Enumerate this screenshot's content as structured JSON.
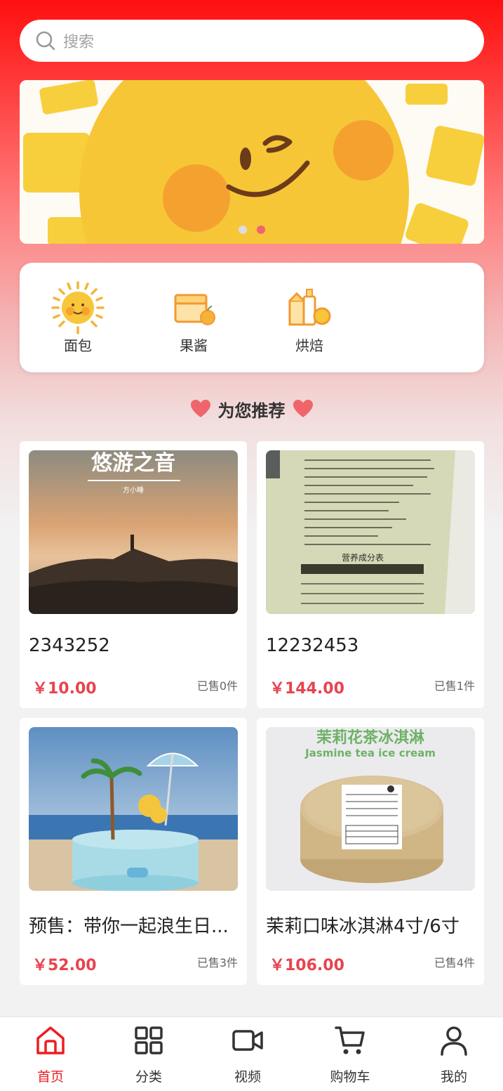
{
  "search": {
    "placeholder": "搜索"
  },
  "banner": {
    "slide_count": 2,
    "active_slide": 2
  },
  "categories": [
    {
      "label": "面包",
      "icon": "sun-bread-icon"
    },
    {
      "label": "果酱",
      "icon": "jam-box-icon"
    },
    {
      "label": "烘焙",
      "icon": "baking-supplies-icon"
    }
  ],
  "recommend": {
    "title": "为您推荐"
  },
  "products": [
    {
      "name": "2343252",
      "price": "￥10.00",
      "sold": "已售0件",
      "image_text": "悠游之音",
      "image_subtext": "方小睡"
    },
    {
      "name": "12232453",
      "price": "￥144.00",
      "sold": "已售1件",
      "image_text": "营养成分表"
    },
    {
      "name": "预售：带你一起浪生日...",
      "price": "￥52.00",
      "sold": "已售3件"
    },
    {
      "name": "茉莉口味冰淇淋4寸/6寸",
      "price": "￥106.00",
      "sold": "已售4件",
      "image_text": "茉莉花茶冰淇淋",
      "image_subtext": "Jasmine tea ice cream"
    }
  ],
  "tabbar": [
    {
      "label": "首页",
      "icon": "home-icon",
      "active": true
    },
    {
      "label": "分类",
      "icon": "grid-icon",
      "active": false
    },
    {
      "label": "视频",
      "icon": "video-icon",
      "active": false
    },
    {
      "label": "购物车",
      "icon": "cart-icon",
      "active": false
    },
    {
      "label": "我的",
      "icon": "user-icon",
      "active": false
    }
  ],
  "colors": {
    "accent": "#ee1c25",
    "price": "#e8434e",
    "heart": "#f0656b"
  }
}
